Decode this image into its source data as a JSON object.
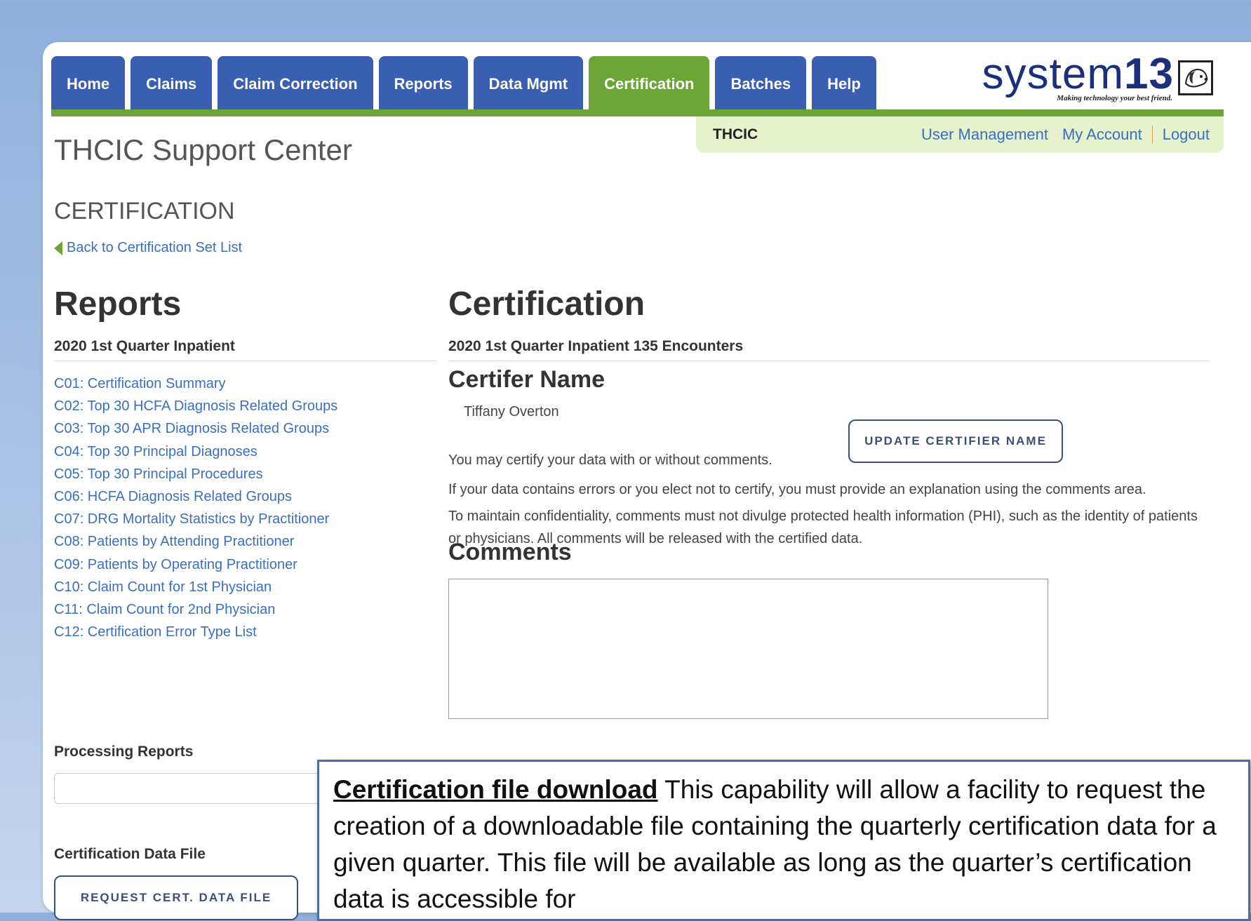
{
  "nav": {
    "tabs": [
      {
        "label": "Home",
        "active": false
      },
      {
        "label": "Claims",
        "active": false
      },
      {
        "label": "Claim Correction",
        "active": false
      },
      {
        "label": "Reports",
        "active": false
      },
      {
        "label": "Data Mgmt",
        "active": false
      },
      {
        "label": "Certification",
        "active": true
      },
      {
        "label": "Batches",
        "active": false
      },
      {
        "label": "Help",
        "active": false
      }
    ]
  },
  "logo": {
    "word": "system",
    "number": "13",
    "tagline": "Making technology your best friend."
  },
  "subbar": {
    "org": "THCIC",
    "user_management": "User Management",
    "my_account": "My Account",
    "logout": "Logout"
  },
  "header": {
    "site_title": "THCIC Support Center",
    "section_title": "CERTIFICATION",
    "back_link": "Back to Certification Set List"
  },
  "left": {
    "title": "Reports",
    "subtitle": "2020 1st Quarter Inpatient",
    "reports": [
      "C01: Certification Summary",
      "C02: Top 30 HCFA Diagnosis Related Groups",
      "C03: Top 30 APR Diagnosis Related Groups",
      "C04: Top 30 Principal Diagnoses",
      "C05: Top 30 Principal Procedures",
      "C06: HCFA Diagnosis Related Groups",
      "C07: DRG Mortality Statistics by Practitioner",
      "C08: Patients by Attending Practitioner",
      "C09: Patients by Operating Practitioner",
      "C10: Claim Count for 1st Physician",
      "C11: Claim Count for 2nd Physician",
      "C12: Certification Error Type List"
    ],
    "processing_reports_label": "Processing Reports",
    "processing_reports_value": "",
    "cert_data_file_label": "Certification Data File",
    "request_button": "REQUEST CERT. DATA FILE"
  },
  "right": {
    "title": "Certification",
    "encounters": "2020 1st Quarter Inpatient 135 Encounters",
    "certifier_heading": "Certifer Name",
    "certifier_name": "Tiffany Overton",
    "update_button": "UPDATE CERTIFIER NAME",
    "info1": "You may certify your data with or without comments.",
    "info2": "If your data contains errors or you elect not to certify, you must provide an explanation using the comments area.",
    "info3": "To maintain confidentiality, comments must not divulge protected health information (PHI), such as the identity of patients or physicians. All comments will be released with the certified data.",
    "comments_heading": "Comments",
    "comments_value": ""
  },
  "callout": {
    "bold": "Certification file download",
    "text": " This capability will allow a facility to request the creation of a downloadable file containing the quarterly certification data for a given quarter. This file will be available as long as the quarter’s certification data is accessible for"
  }
}
